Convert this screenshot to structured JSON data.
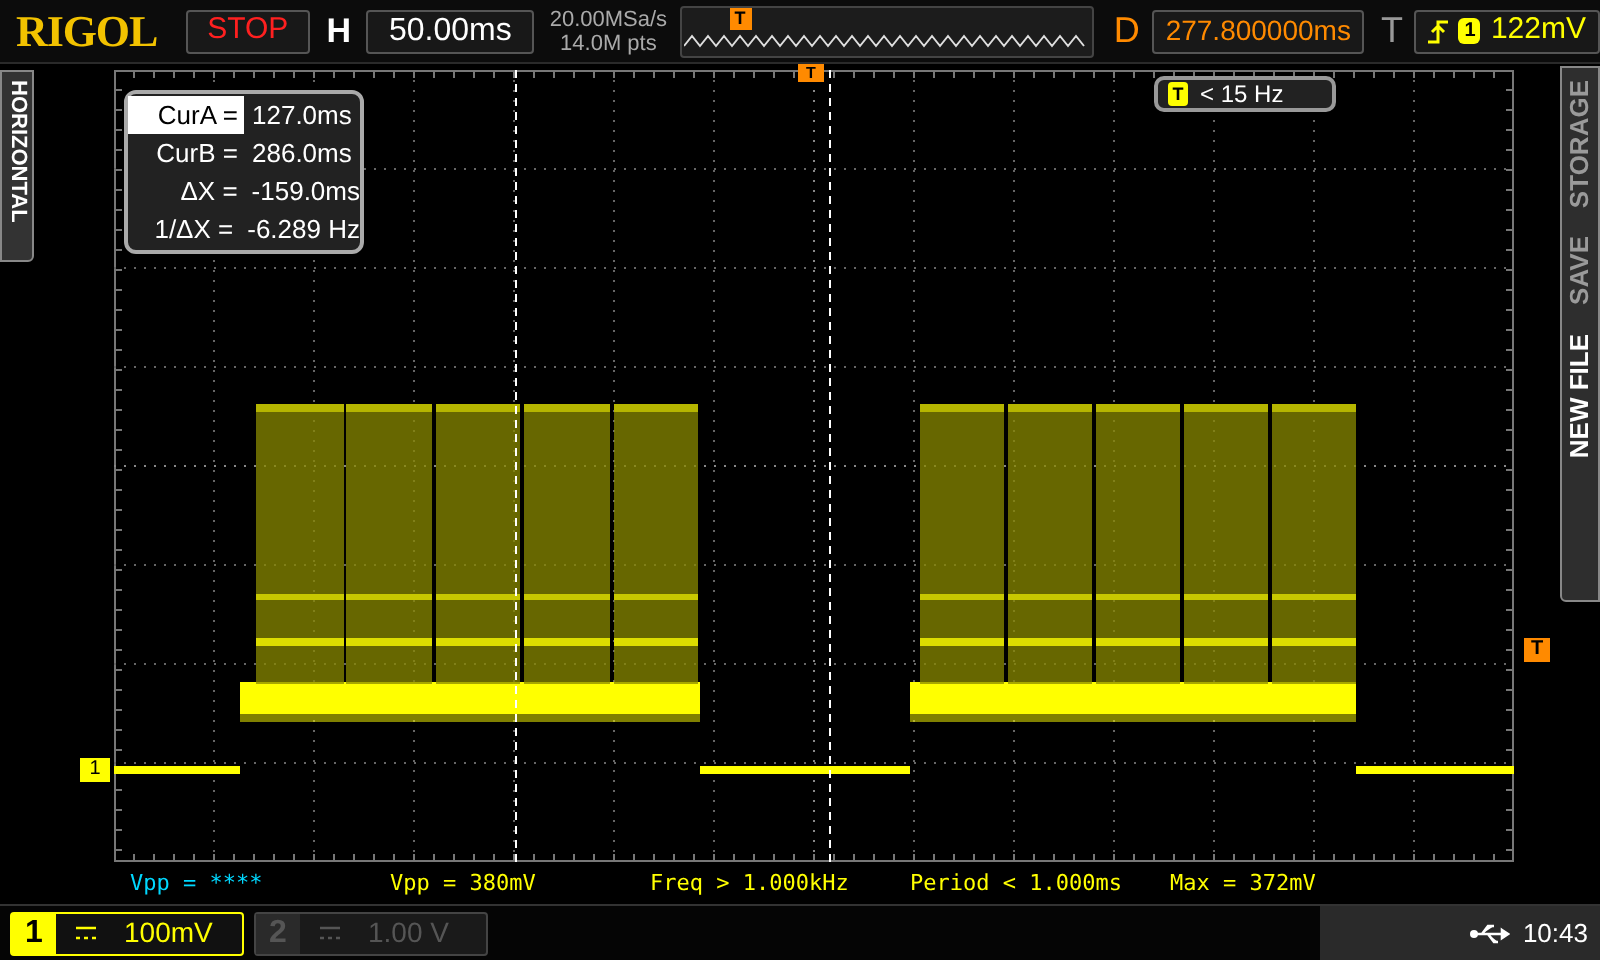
{
  "brand": "RIGOL",
  "run_state": "STOP",
  "horizontal": {
    "label": "H",
    "timebase": "50.00ms",
    "sample_rate": "20.00MSa/s",
    "memory_depth": "14.0M pts",
    "overview_marker": "T"
  },
  "delay": {
    "label": "D",
    "value": "277.800000ms"
  },
  "trigger": {
    "label": "T",
    "source": "1",
    "level": "122mV"
  },
  "left_menu": {
    "label": "HORIZONTAL"
  },
  "right_menu": [
    {
      "label": "NEW FILE",
      "selected": true
    },
    {
      "label": "SAVE",
      "selected": false
    },
    {
      "label": "STORAGE",
      "selected": false
    }
  ],
  "screen": {
    "trigger_position_marker": "T",
    "trigger_level_marker": "T",
    "channel_marker": "1",
    "cursor_panel": [
      {
        "label": "CurA =",
        "value": "127.0ms",
        "selected": true
      },
      {
        "label": "CurB =",
        "value": "286.0ms",
        "selected": false
      },
      {
        "label": "ΔX =",
        "value": "-159.0ms",
        "selected": false
      },
      {
        "label": "1/ΔX =",
        "value": "-6.289 Hz",
        "selected": false
      }
    ],
    "trigger_frequency": {
      "badge": "T",
      "text": "< 15 Hz"
    }
  },
  "measurements": [
    {
      "text": "Vpp = ****",
      "color": "#00d8ff"
    },
    {
      "text": "Vpp = 380mV",
      "color": "#ffff00"
    },
    {
      "text": "Freq > 1.000kHz",
      "color": "#ffff00"
    },
    {
      "text": "Period < 1.000ms",
      "color": "#ffff00"
    },
    {
      "text": "Max = 372mV",
      "color": "#ffff00"
    }
  ],
  "channels": [
    {
      "number": "1",
      "scale": "100mV",
      "enabled": true
    },
    {
      "number": "2",
      "scale": "1.00 V",
      "enabled": false
    }
  ],
  "time": "10:43"
}
